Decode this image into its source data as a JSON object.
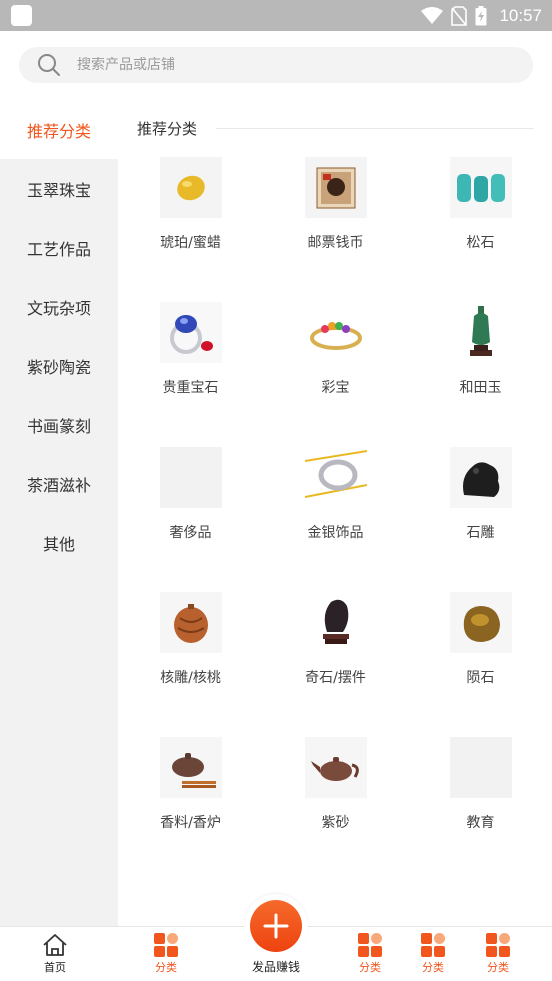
{
  "status_bar": {
    "time": "10:57"
  },
  "search": {
    "placeholder": "搜索产品或店铺"
  },
  "sidebar": {
    "items": [
      {
        "label": "推荐分类",
        "active": true
      },
      {
        "label": "玉翠珠宝",
        "active": false
      },
      {
        "label": "工艺作品",
        "active": false
      },
      {
        "label": "文玩杂项",
        "active": false
      },
      {
        "label": "紫砂陶瓷",
        "active": false
      },
      {
        "label": "书画篆刻",
        "active": false
      },
      {
        "label": "茶酒滋补",
        "active": false
      },
      {
        "label": "其他",
        "active": false
      }
    ]
  },
  "main": {
    "section_title": "推荐分类",
    "categories": [
      {
        "label": "琥珀/蜜蜡",
        "icon": "amber-icon"
      },
      {
        "label": "邮票钱币",
        "icon": "stamp-icon"
      },
      {
        "label": "松石",
        "icon": "turquoise-icon"
      },
      {
        "label": "贵重宝石",
        "icon": "gem-ring-icon"
      },
      {
        "label": "彩宝",
        "icon": "colored-gem-ring-icon"
      },
      {
        "label": "和田玉",
        "icon": "jade-vase-icon"
      },
      {
        "label": "奢侈品",
        "icon": ""
      },
      {
        "label": "金银饰品",
        "icon": "silver-ring-icon"
      },
      {
        "label": "石雕",
        "icon": "stone-dragon-icon"
      },
      {
        "label": "核雕/核桃",
        "icon": "walnut-icon"
      },
      {
        "label": "奇石/摆件",
        "icon": "rock-ornament-icon"
      },
      {
        "label": "陨石",
        "icon": "meteorite-icon"
      },
      {
        "label": "香料/香炉",
        "icon": "incense-burner-icon"
      },
      {
        "label": "紫砂",
        "icon": "teapot-icon"
      },
      {
        "label": "教育",
        "icon": ""
      }
    ]
  },
  "tabbar": {
    "home": "首页",
    "tab2": "分类",
    "center": "发品赚钱",
    "tab4": "分类",
    "tab5": "分类",
    "tab6": "分类"
  },
  "colors": {
    "accent": "#f0561d",
    "sidebar_bg": "#f2f2f2",
    "status_bar": "#b8b8b8"
  }
}
